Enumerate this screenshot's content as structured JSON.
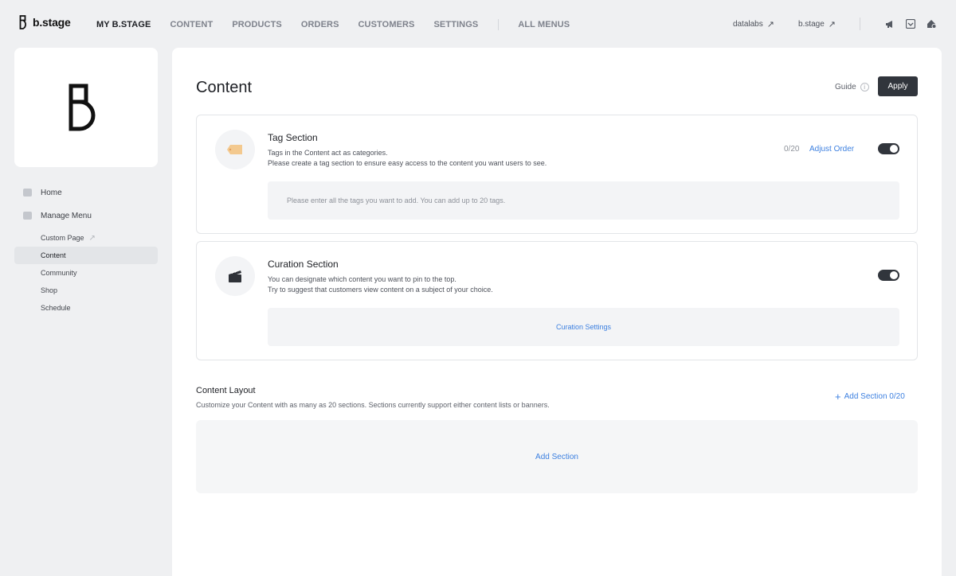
{
  "brand": {
    "name": "b.stage"
  },
  "nav": {
    "items": [
      "MY B.STAGE",
      "CONTENT",
      "PRODUCTS",
      "ORDERS",
      "CUSTOMERS",
      "SETTINGS"
    ],
    "all_menus": "ALL MENUS"
  },
  "top_right": {
    "links": [
      "datalabs",
      "b.stage"
    ],
    "icons": [
      "megaphone-icon",
      "inbox-icon",
      "home-settings-icon"
    ]
  },
  "sidebar": {
    "items": [
      {
        "label": "Home",
        "icon": "home-icon"
      },
      {
        "label": "Manage Menu",
        "icon": "menu-icon"
      }
    ],
    "subitems": [
      "Custom Page",
      "Content",
      "Community",
      "Shop",
      "Schedule"
    ],
    "active_subitem": "Content"
  },
  "main": {
    "title": "Content",
    "guide_label": "Guide",
    "apply_label": "Apply",
    "tag_section": {
      "title": "Tag Section",
      "desc_line1": "Tags in the Content act as categories.",
      "desc_line2": "Please create a tag section to ensure easy access to the content you want users to see.",
      "count": "0/20",
      "link": "Adjust Order",
      "enabled": true,
      "placeholder": "Please enter all the tags you want to add. You can add up to 20 tags."
    },
    "curation_section": {
      "title": "Curation Section",
      "desc_line1": "You can designate which content you want to pin to the top.",
      "desc_line2": "Try to suggest that customers view content on a subject of your choice.",
      "enabled": true,
      "settings_link": "Curation Settings"
    },
    "content_layout": {
      "title": "Content Layout",
      "desc": "Customize your Content with as many as 20 sections. Sections currently support either content lists or banners.",
      "add_link": "Add Section 0/20",
      "add_button": "Add Section"
    }
  },
  "colors": {
    "accent": "#3d80e0",
    "dark": "#31353c",
    "background": "#eff0f2"
  }
}
